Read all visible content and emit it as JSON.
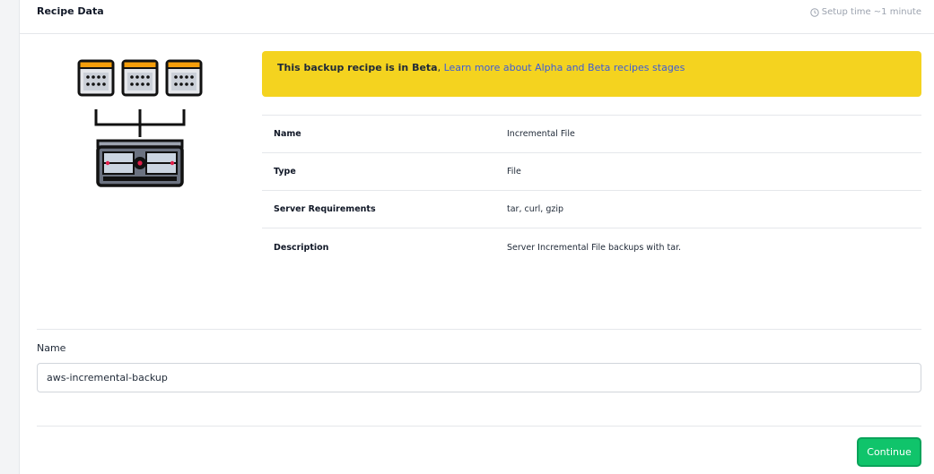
{
  "header": {
    "title": "Recipe Data",
    "setup_time": "Setup time ~1 minute"
  },
  "banner": {
    "strong_text": "This backup recipe is in Beta",
    "separator": ", ",
    "link_text": "Learn more about Alpha and Beta recipes stages",
    "color": "#f4d31f"
  },
  "recipe_info": [
    {
      "key": "Name",
      "value": "Incremental File"
    },
    {
      "key": "Type",
      "value": "File"
    },
    {
      "key": "Server Requirements",
      "value": "tar, curl, gzip"
    },
    {
      "key": "Description",
      "value": "Server Incremental File backups with tar."
    }
  ],
  "form": {
    "name_label": "Name",
    "name_value": "aws-incremental-backup"
  },
  "actions": {
    "continue_label": "Continue",
    "continue_color": "#10c46b"
  },
  "icons": {
    "illustration": "server-backup-illustration",
    "clock": "clock-icon"
  }
}
